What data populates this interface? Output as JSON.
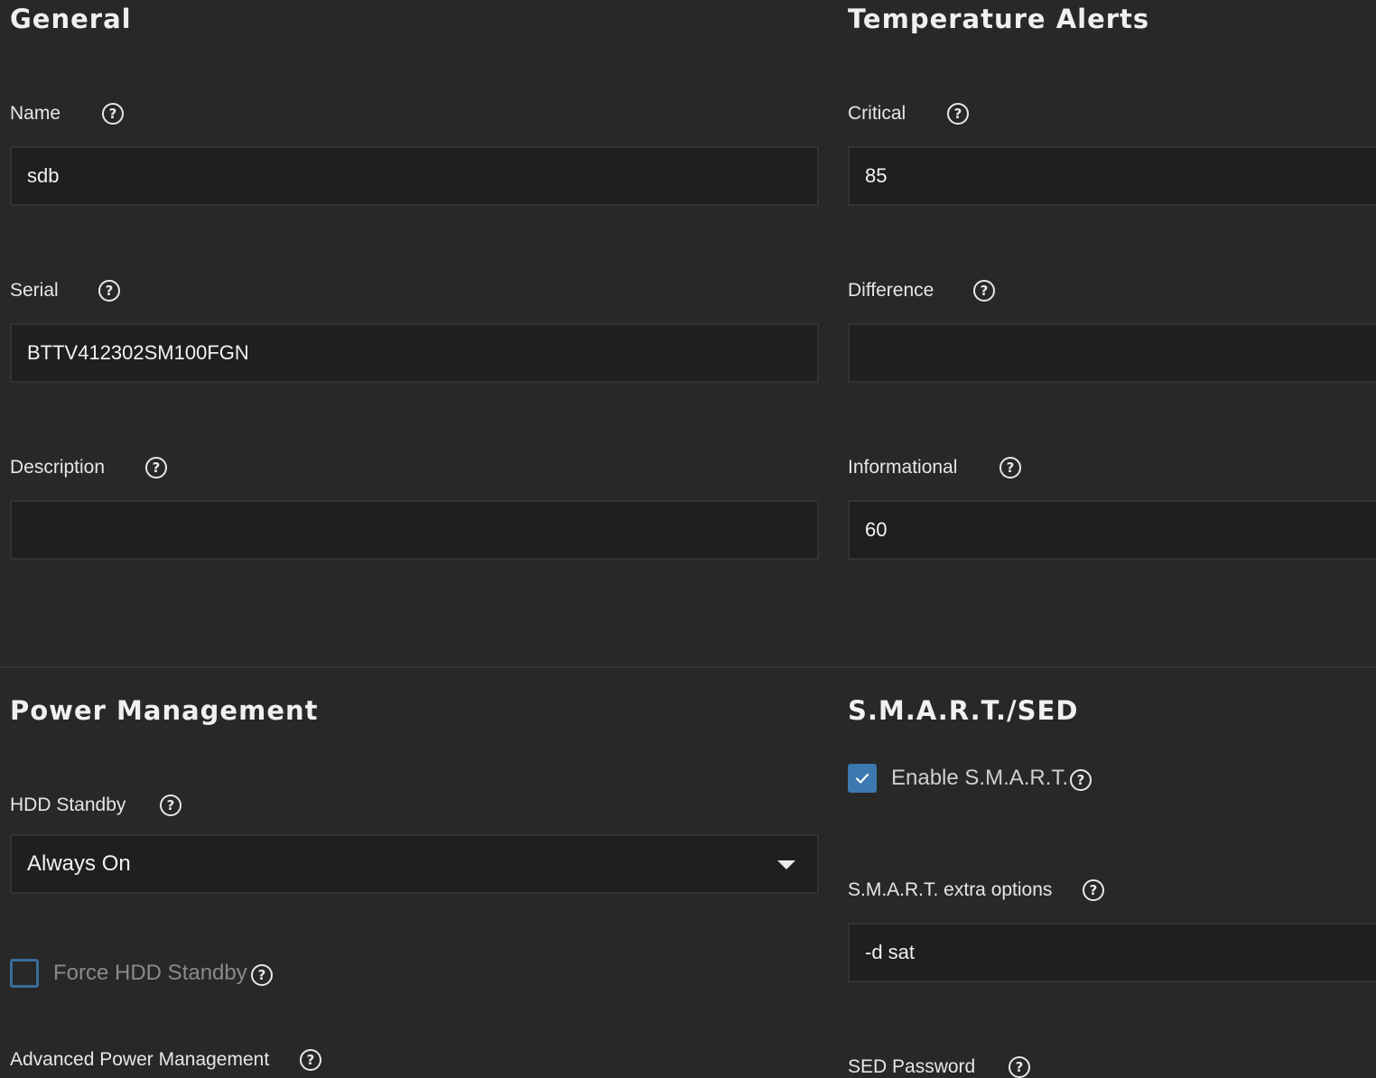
{
  "general": {
    "title": "General",
    "name_label": "Name",
    "name_value": "sdb",
    "serial_label": "Serial",
    "serial_value": "BTTV412302SM100FGN",
    "description_label": "Description",
    "description_value": ""
  },
  "temperature": {
    "title": "Temperature Alerts",
    "critical_label": "Critical",
    "critical_value": "85",
    "difference_label": "Difference",
    "difference_value": "",
    "informational_label": "Informational",
    "informational_value": "60"
  },
  "power": {
    "title": "Power Management",
    "hdd_standby_label": "HDD Standby",
    "hdd_standby_value": "Always On",
    "force_standby_label": "Force HDD Standby",
    "force_standby_checked": false,
    "apm_label": "Advanced Power Management"
  },
  "smart": {
    "title": "S.M.A.R.T./SED",
    "enable_label": "Enable S.M.A.R.T.",
    "enable_checked": true,
    "extra_label": "S.M.A.R.T. extra options",
    "extra_value": "-d sat",
    "sed_label": "SED Password"
  },
  "icons": {
    "help": "help-circle-icon",
    "check": "check-icon",
    "caret": "caret-down-icon"
  },
  "colors": {
    "background": "#282828",
    "field_background": "#1f1f1f",
    "accent": "#3d78b0"
  }
}
